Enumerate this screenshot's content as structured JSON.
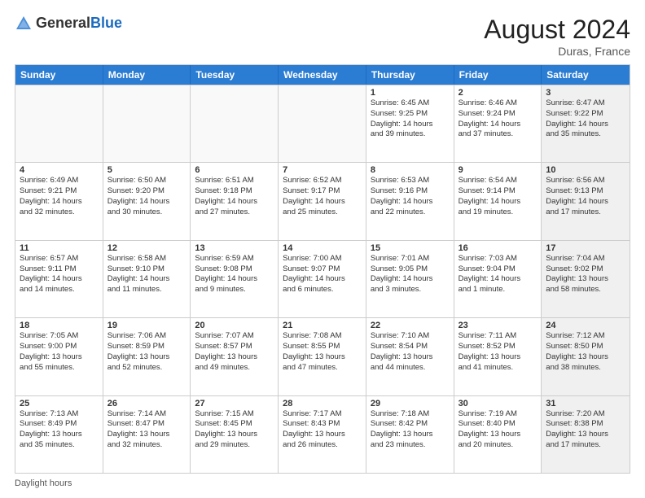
{
  "header": {
    "logo_general": "General",
    "logo_blue": "Blue",
    "month_year": "August 2024",
    "location": "Duras, France"
  },
  "days_of_week": [
    "Sunday",
    "Monday",
    "Tuesday",
    "Wednesday",
    "Thursday",
    "Friday",
    "Saturday"
  ],
  "footer_text": "Daylight hours",
  "weeks": [
    [
      {
        "day": "",
        "empty": true
      },
      {
        "day": "",
        "empty": true
      },
      {
        "day": "",
        "empty": true
      },
      {
        "day": "",
        "empty": true
      },
      {
        "day": "1",
        "lines": [
          "Sunrise: 6:45 AM",
          "Sunset: 9:25 PM",
          "Daylight: 14 hours",
          "and 39 minutes."
        ]
      },
      {
        "day": "2",
        "lines": [
          "Sunrise: 6:46 AM",
          "Sunset: 9:24 PM",
          "Daylight: 14 hours",
          "and 37 minutes."
        ]
      },
      {
        "day": "3",
        "lines": [
          "Sunrise: 6:47 AM",
          "Sunset: 9:22 PM",
          "Daylight: 14 hours",
          "and 35 minutes."
        ],
        "shaded": true
      }
    ],
    [
      {
        "day": "4",
        "lines": [
          "Sunrise: 6:49 AM",
          "Sunset: 9:21 PM",
          "Daylight: 14 hours",
          "and 32 minutes."
        ]
      },
      {
        "day": "5",
        "lines": [
          "Sunrise: 6:50 AM",
          "Sunset: 9:20 PM",
          "Daylight: 14 hours",
          "and 30 minutes."
        ]
      },
      {
        "day": "6",
        "lines": [
          "Sunrise: 6:51 AM",
          "Sunset: 9:18 PM",
          "Daylight: 14 hours",
          "and 27 minutes."
        ]
      },
      {
        "day": "7",
        "lines": [
          "Sunrise: 6:52 AM",
          "Sunset: 9:17 PM",
          "Daylight: 14 hours",
          "and 25 minutes."
        ]
      },
      {
        "day": "8",
        "lines": [
          "Sunrise: 6:53 AM",
          "Sunset: 9:16 PM",
          "Daylight: 14 hours",
          "and 22 minutes."
        ]
      },
      {
        "day": "9",
        "lines": [
          "Sunrise: 6:54 AM",
          "Sunset: 9:14 PM",
          "Daylight: 14 hours",
          "and 19 minutes."
        ]
      },
      {
        "day": "10",
        "lines": [
          "Sunrise: 6:56 AM",
          "Sunset: 9:13 PM",
          "Daylight: 14 hours",
          "and 17 minutes."
        ],
        "shaded": true
      }
    ],
    [
      {
        "day": "11",
        "lines": [
          "Sunrise: 6:57 AM",
          "Sunset: 9:11 PM",
          "Daylight: 14 hours",
          "and 14 minutes."
        ]
      },
      {
        "day": "12",
        "lines": [
          "Sunrise: 6:58 AM",
          "Sunset: 9:10 PM",
          "Daylight: 14 hours",
          "and 11 minutes."
        ]
      },
      {
        "day": "13",
        "lines": [
          "Sunrise: 6:59 AM",
          "Sunset: 9:08 PM",
          "Daylight: 14 hours",
          "and 9 minutes."
        ]
      },
      {
        "day": "14",
        "lines": [
          "Sunrise: 7:00 AM",
          "Sunset: 9:07 PM",
          "Daylight: 14 hours",
          "and 6 minutes."
        ]
      },
      {
        "day": "15",
        "lines": [
          "Sunrise: 7:01 AM",
          "Sunset: 9:05 PM",
          "Daylight: 14 hours",
          "and 3 minutes."
        ]
      },
      {
        "day": "16",
        "lines": [
          "Sunrise: 7:03 AM",
          "Sunset: 9:04 PM",
          "Daylight: 14 hours",
          "and 1 minute."
        ]
      },
      {
        "day": "17",
        "lines": [
          "Sunrise: 7:04 AM",
          "Sunset: 9:02 PM",
          "Daylight: 13 hours",
          "and 58 minutes."
        ],
        "shaded": true
      }
    ],
    [
      {
        "day": "18",
        "lines": [
          "Sunrise: 7:05 AM",
          "Sunset: 9:00 PM",
          "Daylight: 13 hours",
          "and 55 minutes."
        ]
      },
      {
        "day": "19",
        "lines": [
          "Sunrise: 7:06 AM",
          "Sunset: 8:59 PM",
          "Daylight: 13 hours",
          "and 52 minutes."
        ]
      },
      {
        "day": "20",
        "lines": [
          "Sunrise: 7:07 AM",
          "Sunset: 8:57 PM",
          "Daylight: 13 hours",
          "and 49 minutes."
        ]
      },
      {
        "day": "21",
        "lines": [
          "Sunrise: 7:08 AM",
          "Sunset: 8:55 PM",
          "Daylight: 13 hours",
          "and 47 minutes."
        ]
      },
      {
        "day": "22",
        "lines": [
          "Sunrise: 7:10 AM",
          "Sunset: 8:54 PM",
          "Daylight: 13 hours",
          "and 44 minutes."
        ]
      },
      {
        "day": "23",
        "lines": [
          "Sunrise: 7:11 AM",
          "Sunset: 8:52 PM",
          "Daylight: 13 hours",
          "and 41 minutes."
        ]
      },
      {
        "day": "24",
        "lines": [
          "Sunrise: 7:12 AM",
          "Sunset: 8:50 PM",
          "Daylight: 13 hours",
          "and 38 minutes."
        ],
        "shaded": true
      }
    ],
    [
      {
        "day": "25",
        "lines": [
          "Sunrise: 7:13 AM",
          "Sunset: 8:49 PM",
          "Daylight: 13 hours",
          "and 35 minutes."
        ]
      },
      {
        "day": "26",
        "lines": [
          "Sunrise: 7:14 AM",
          "Sunset: 8:47 PM",
          "Daylight: 13 hours",
          "and 32 minutes."
        ]
      },
      {
        "day": "27",
        "lines": [
          "Sunrise: 7:15 AM",
          "Sunset: 8:45 PM",
          "Daylight: 13 hours",
          "and 29 minutes."
        ]
      },
      {
        "day": "28",
        "lines": [
          "Sunrise: 7:17 AM",
          "Sunset: 8:43 PM",
          "Daylight: 13 hours",
          "and 26 minutes."
        ]
      },
      {
        "day": "29",
        "lines": [
          "Sunrise: 7:18 AM",
          "Sunset: 8:42 PM",
          "Daylight: 13 hours",
          "and 23 minutes."
        ]
      },
      {
        "day": "30",
        "lines": [
          "Sunrise: 7:19 AM",
          "Sunset: 8:40 PM",
          "Daylight: 13 hours",
          "and 20 minutes."
        ]
      },
      {
        "day": "31",
        "lines": [
          "Sunrise: 7:20 AM",
          "Sunset: 8:38 PM",
          "Daylight: 13 hours",
          "and 17 minutes."
        ],
        "shaded": true
      }
    ]
  ]
}
